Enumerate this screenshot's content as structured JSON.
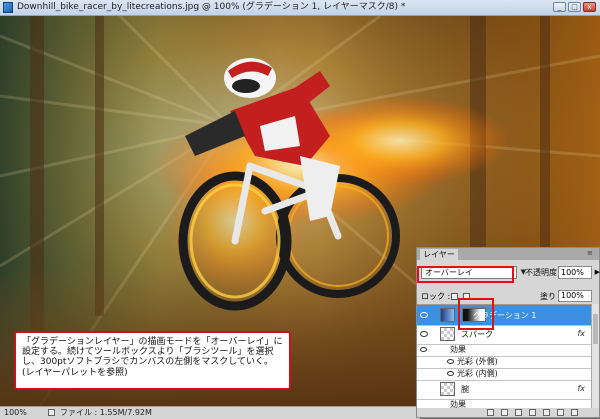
{
  "window": {
    "title": "Downhill_bike_racer_by_litecreations.jpg @ 100% (グラデーション 1, レイヤーマスク/8) *"
  },
  "status": {
    "zoom": "100%",
    "file_info": "ファイル : 1.55M/7.92M"
  },
  "layers_panel": {
    "tab_label": "レイヤー",
    "blend_mode": "オーバーレイ",
    "opacity_label": "不透明度 :",
    "opacity_value": "100%",
    "lock_label": "ロック :",
    "fill_label": "塗り :",
    "fill_value": "100%",
    "layers": [
      {
        "name": "グラデーション 1",
        "selected": true
      },
      {
        "name": "スパーク",
        "fx": "fx"
      },
      {
        "name": "効果"
      },
      {
        "name": "光彩 (外側)"
      },
      {
        "name": "光彩 (内側)"
      },
      {
        "name": "腕",
        "fx": "fx"
      },
      {
        "name": "効果"
      }
    ]
  },
  "callout": {
    "text": "「グラデーションレイヤー」の描画モードを「オーバーレイ」に設定する。続けてツールボックスより「ブラシツール」を選択し、300ptソフトブラシでカンバスの左側をマスクしていく。(レイヤーパレットを参照)"
  },
  "colors": {
    "highlight": "#e0101a",
    "selected_layer": "#3d8fe0"
  }
}
